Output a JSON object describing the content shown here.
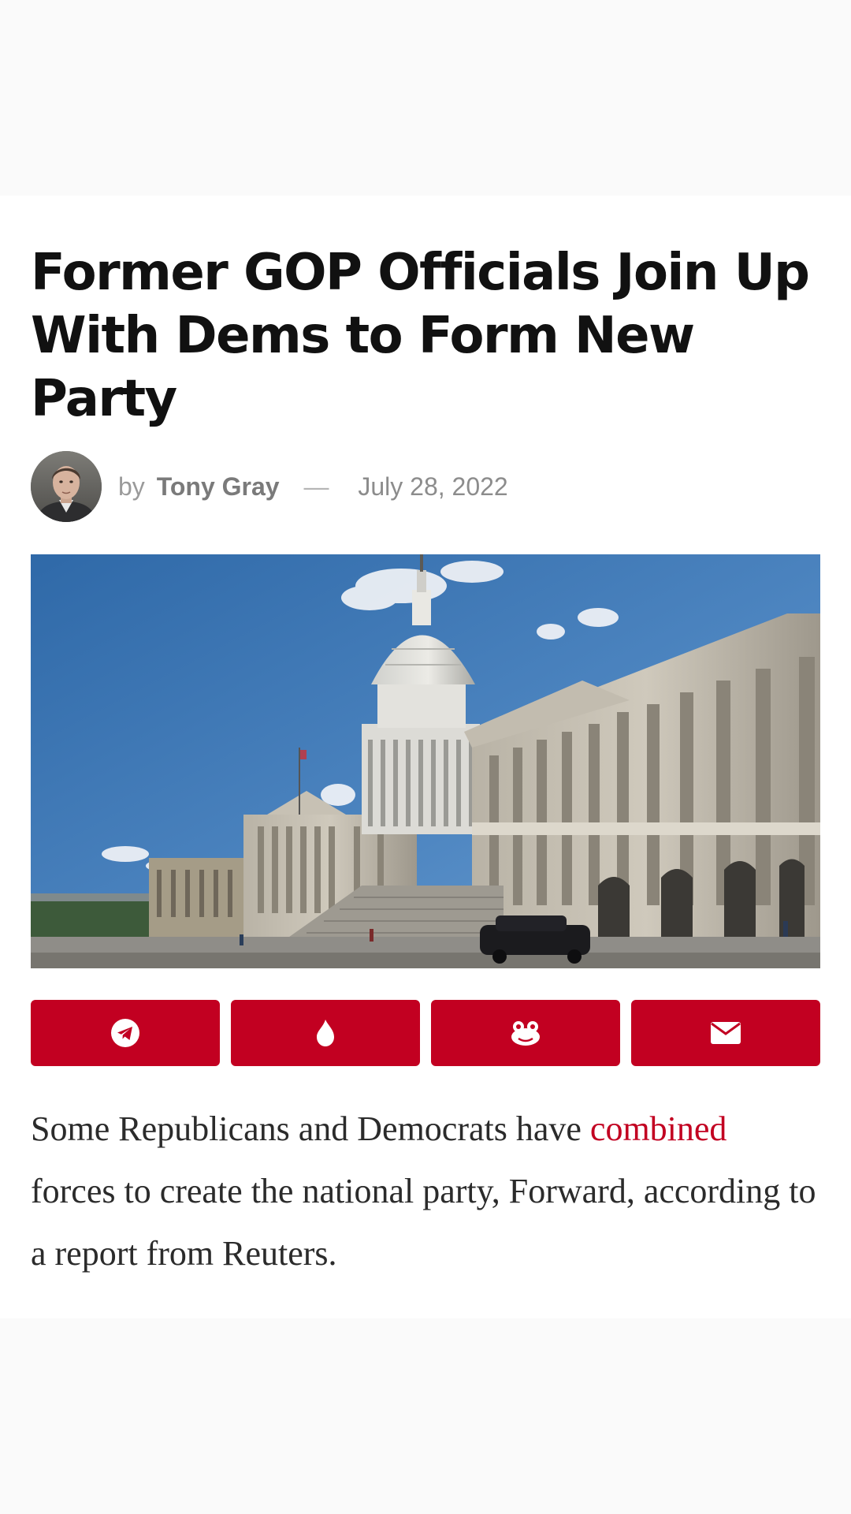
{
  "article": {
    "title": "Former GOP Officials Join Up With Dems to Form New Party",
    "byline": {
      "by": "by",
      "author": "Tony Gray",
      "separator": "—",
      "date": "July 28, 2022"
    },
    "share_buttons": [
      {
        "icon": "telegram-icon"
      },
      {
        "icon": "gab-flame-icon"
      },
      {
        "icon": "frog-icon"
      },
      {
        "icon": "envelope-icon"
      }
    ],
    "body": {
      "before_link": "Some Republicans and Democrats have ",
      "link_text": "combined",
      "after_link": " forces to create the national party, Forward, according to a report from Reuters."
    }
  },
  "colors": {
    "accent": "#c20021",
    "title": "#111111",
    "body_text": "#2b2b2b",
    "meta_text": "#8a8a8a",
    "page_background": "#fafafa",
    "article_background": "#ffffff"
  }
}
